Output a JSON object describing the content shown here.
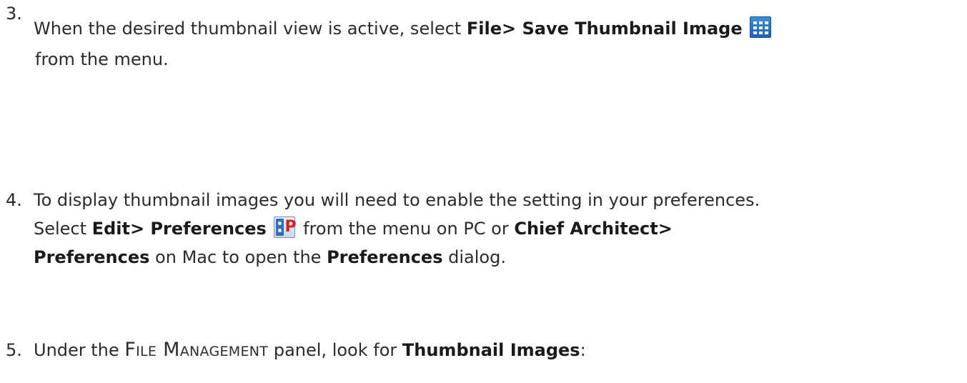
{
  "steps": [
    {
      "number": "3.",
      "t1": "When the desired thumbnail view is active, select ",
      "b1": "File> Save Thumbnail Image",
      "icon": "save-thumbnail-grid-icon",
      "t2": "from the menu."
    },
    {
      "number": "4.",
      "t1": "To display thumbnail images you will need to enable the setting in your preferences.",
      "t2": "Select ",
      "b1": "Edit> Preferences",
      "icon": "preferences-icon",
      "t3": " from the menu on PC or ",
      "b2": "Chief Architect>",
      "b3": "Preferences",
      "t4": " on Mac to open the ",
      "b4": "Preferences",
      "t5": " dialog."
    },
    {
      "number": "5.",
      "t1": "Under the ",
      "sc1": "File Management",
      "t2": " panel, look for ",
      "b1": "Thumbnail Images",
      "t3": ":"
    }
  ],
  "colors": {
    "text": "#2b2b2b",
    "icon_blue": "#1c64b6",
    "icon_red": "#d21f1f"
  }
}
